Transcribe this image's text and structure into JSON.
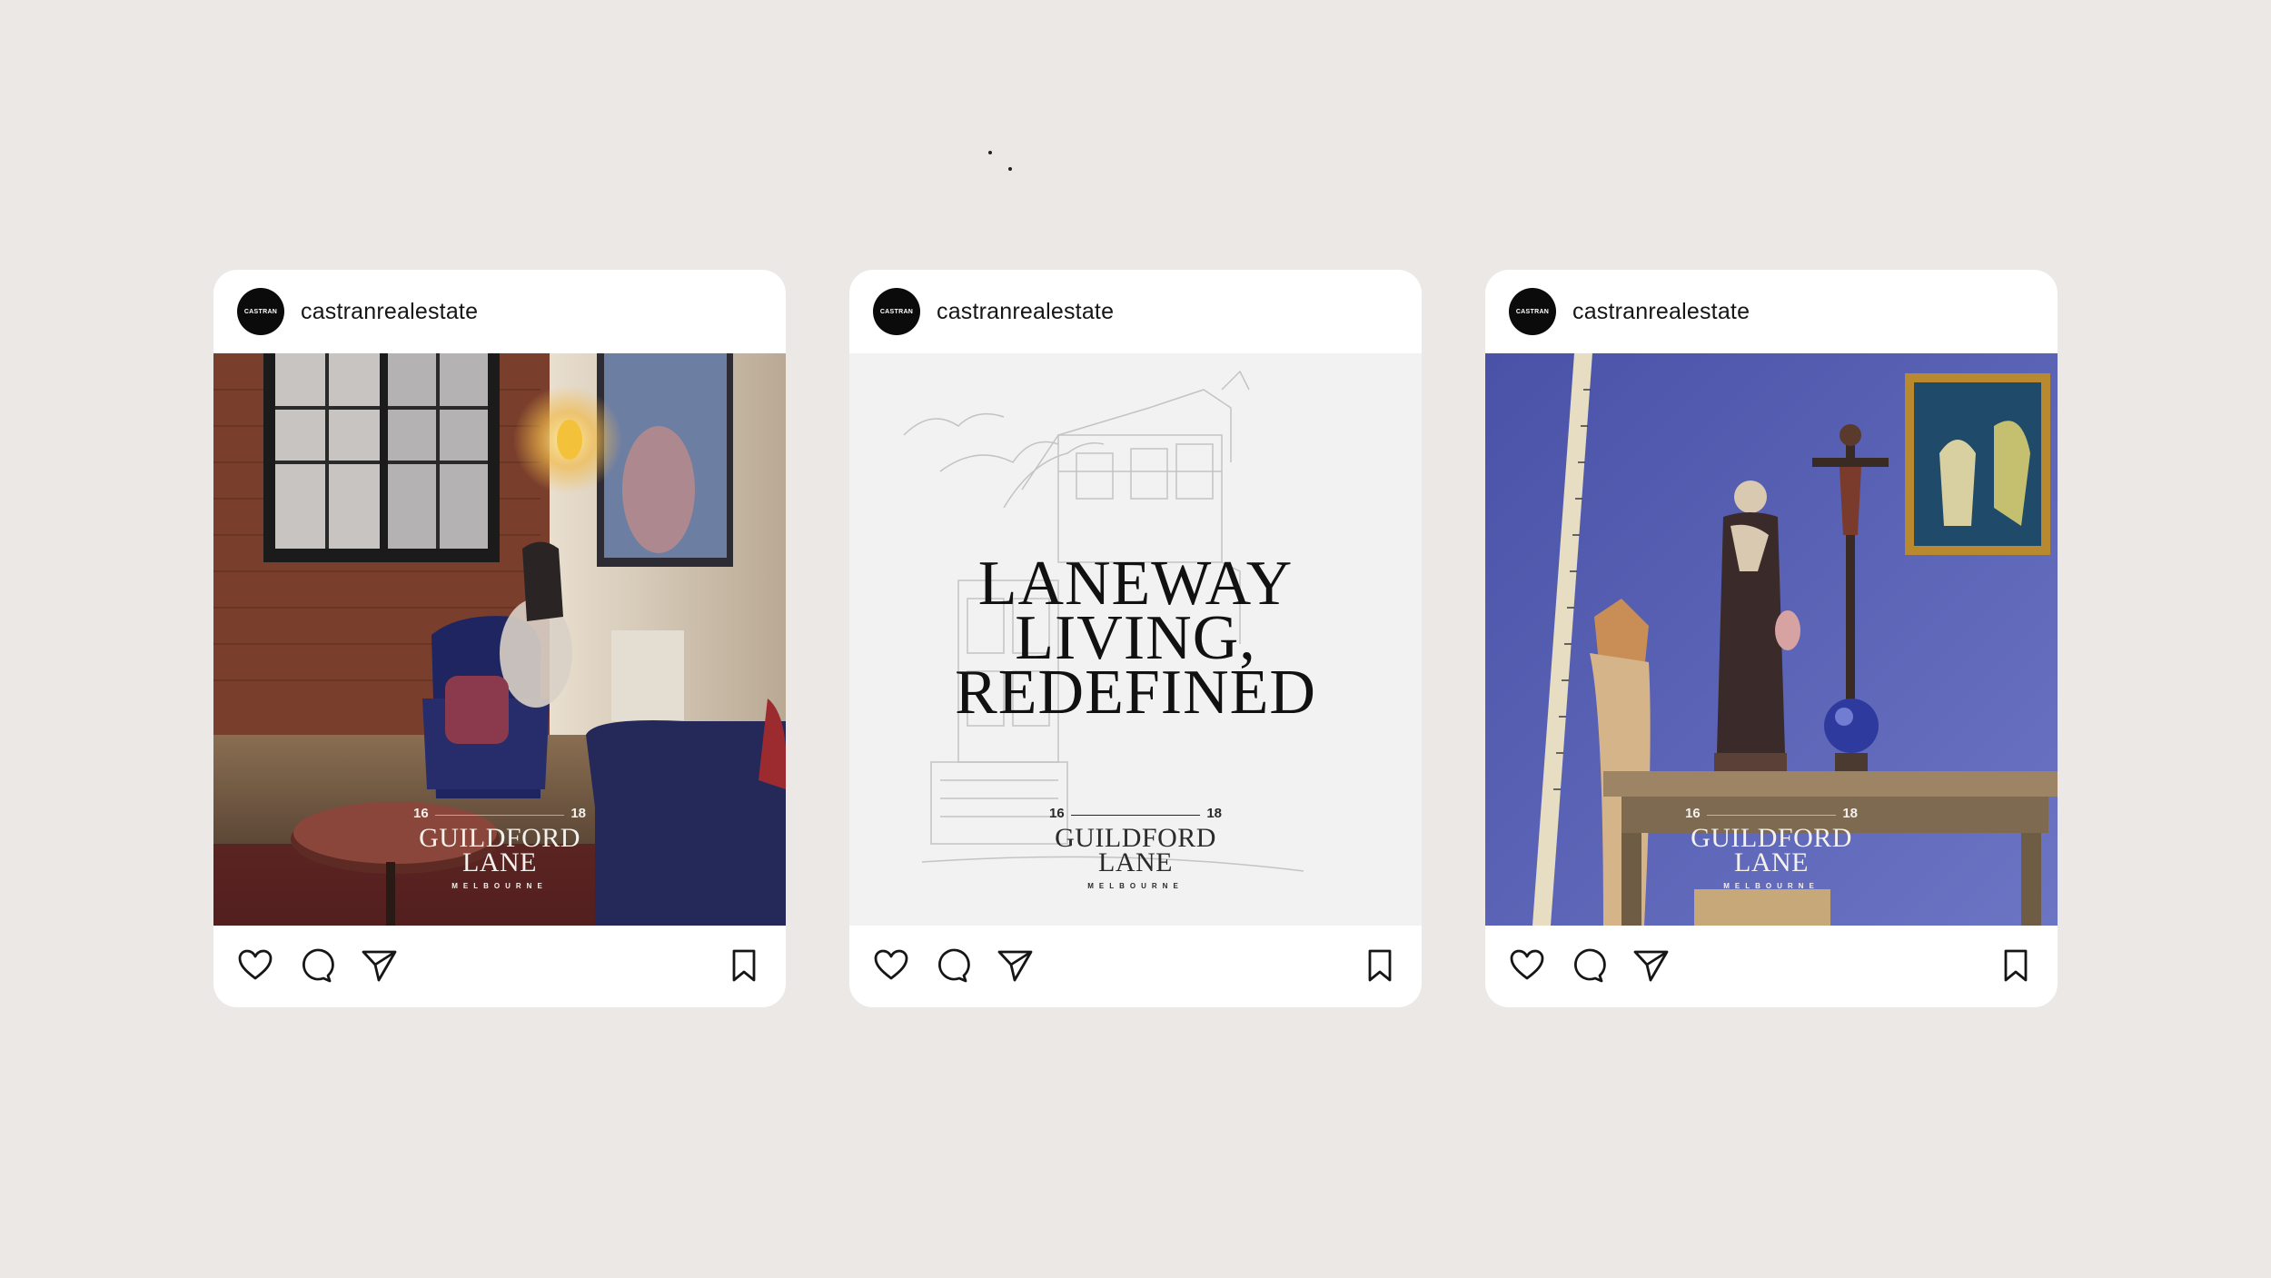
{
  "posts": [
    {
      "username": "castranrealestate",
      "avatar_text": "CASTRAN",
      "image": "loft-living-room-photo",
      "logo": {
        "left_num": "16",
        "right_num": "18",
        "line1": "GUILDFORD",
        "line2": "LANE",
        "city": "MELBOURNE"
      }
    },
    {
      "username": "castranrealestate",
      "avatar_text": "CASTRAN",
      "image": "building-sketch",
      "headline": [
        "LANEWAY",
        "LIVING,",
        "REDEFINED"
      ],
      "logo": {
        "left_num": "16",
        "right_num": "18",
        "line1": "GUILDFORD",
        "line2": "LANE",
        "city": "MELBOURNE"
      }
    },
    {
      "username": "castranrealestate",
      "avatar_text": "CASTRAN",
      "image": "blue-wall-curiosities-photo",
      "logo": {
        "left_num": "16",
        "right_num": "18",
        "line1": "GUILDFORD",
        "line2": "LANE",
        "city": "MELBOURNE"
      }
    }
  ],
  "icons": {
    "like": "heart-icon",
    "comment": "comment-icon",
    "share": "send-icon",
    "save": "bookmark-icon"
  },
  "colors": {
    "background": "#ebe8e5",
    "card": "#ffffff",
    "avatar": "#0b0b0b"
  }
}
